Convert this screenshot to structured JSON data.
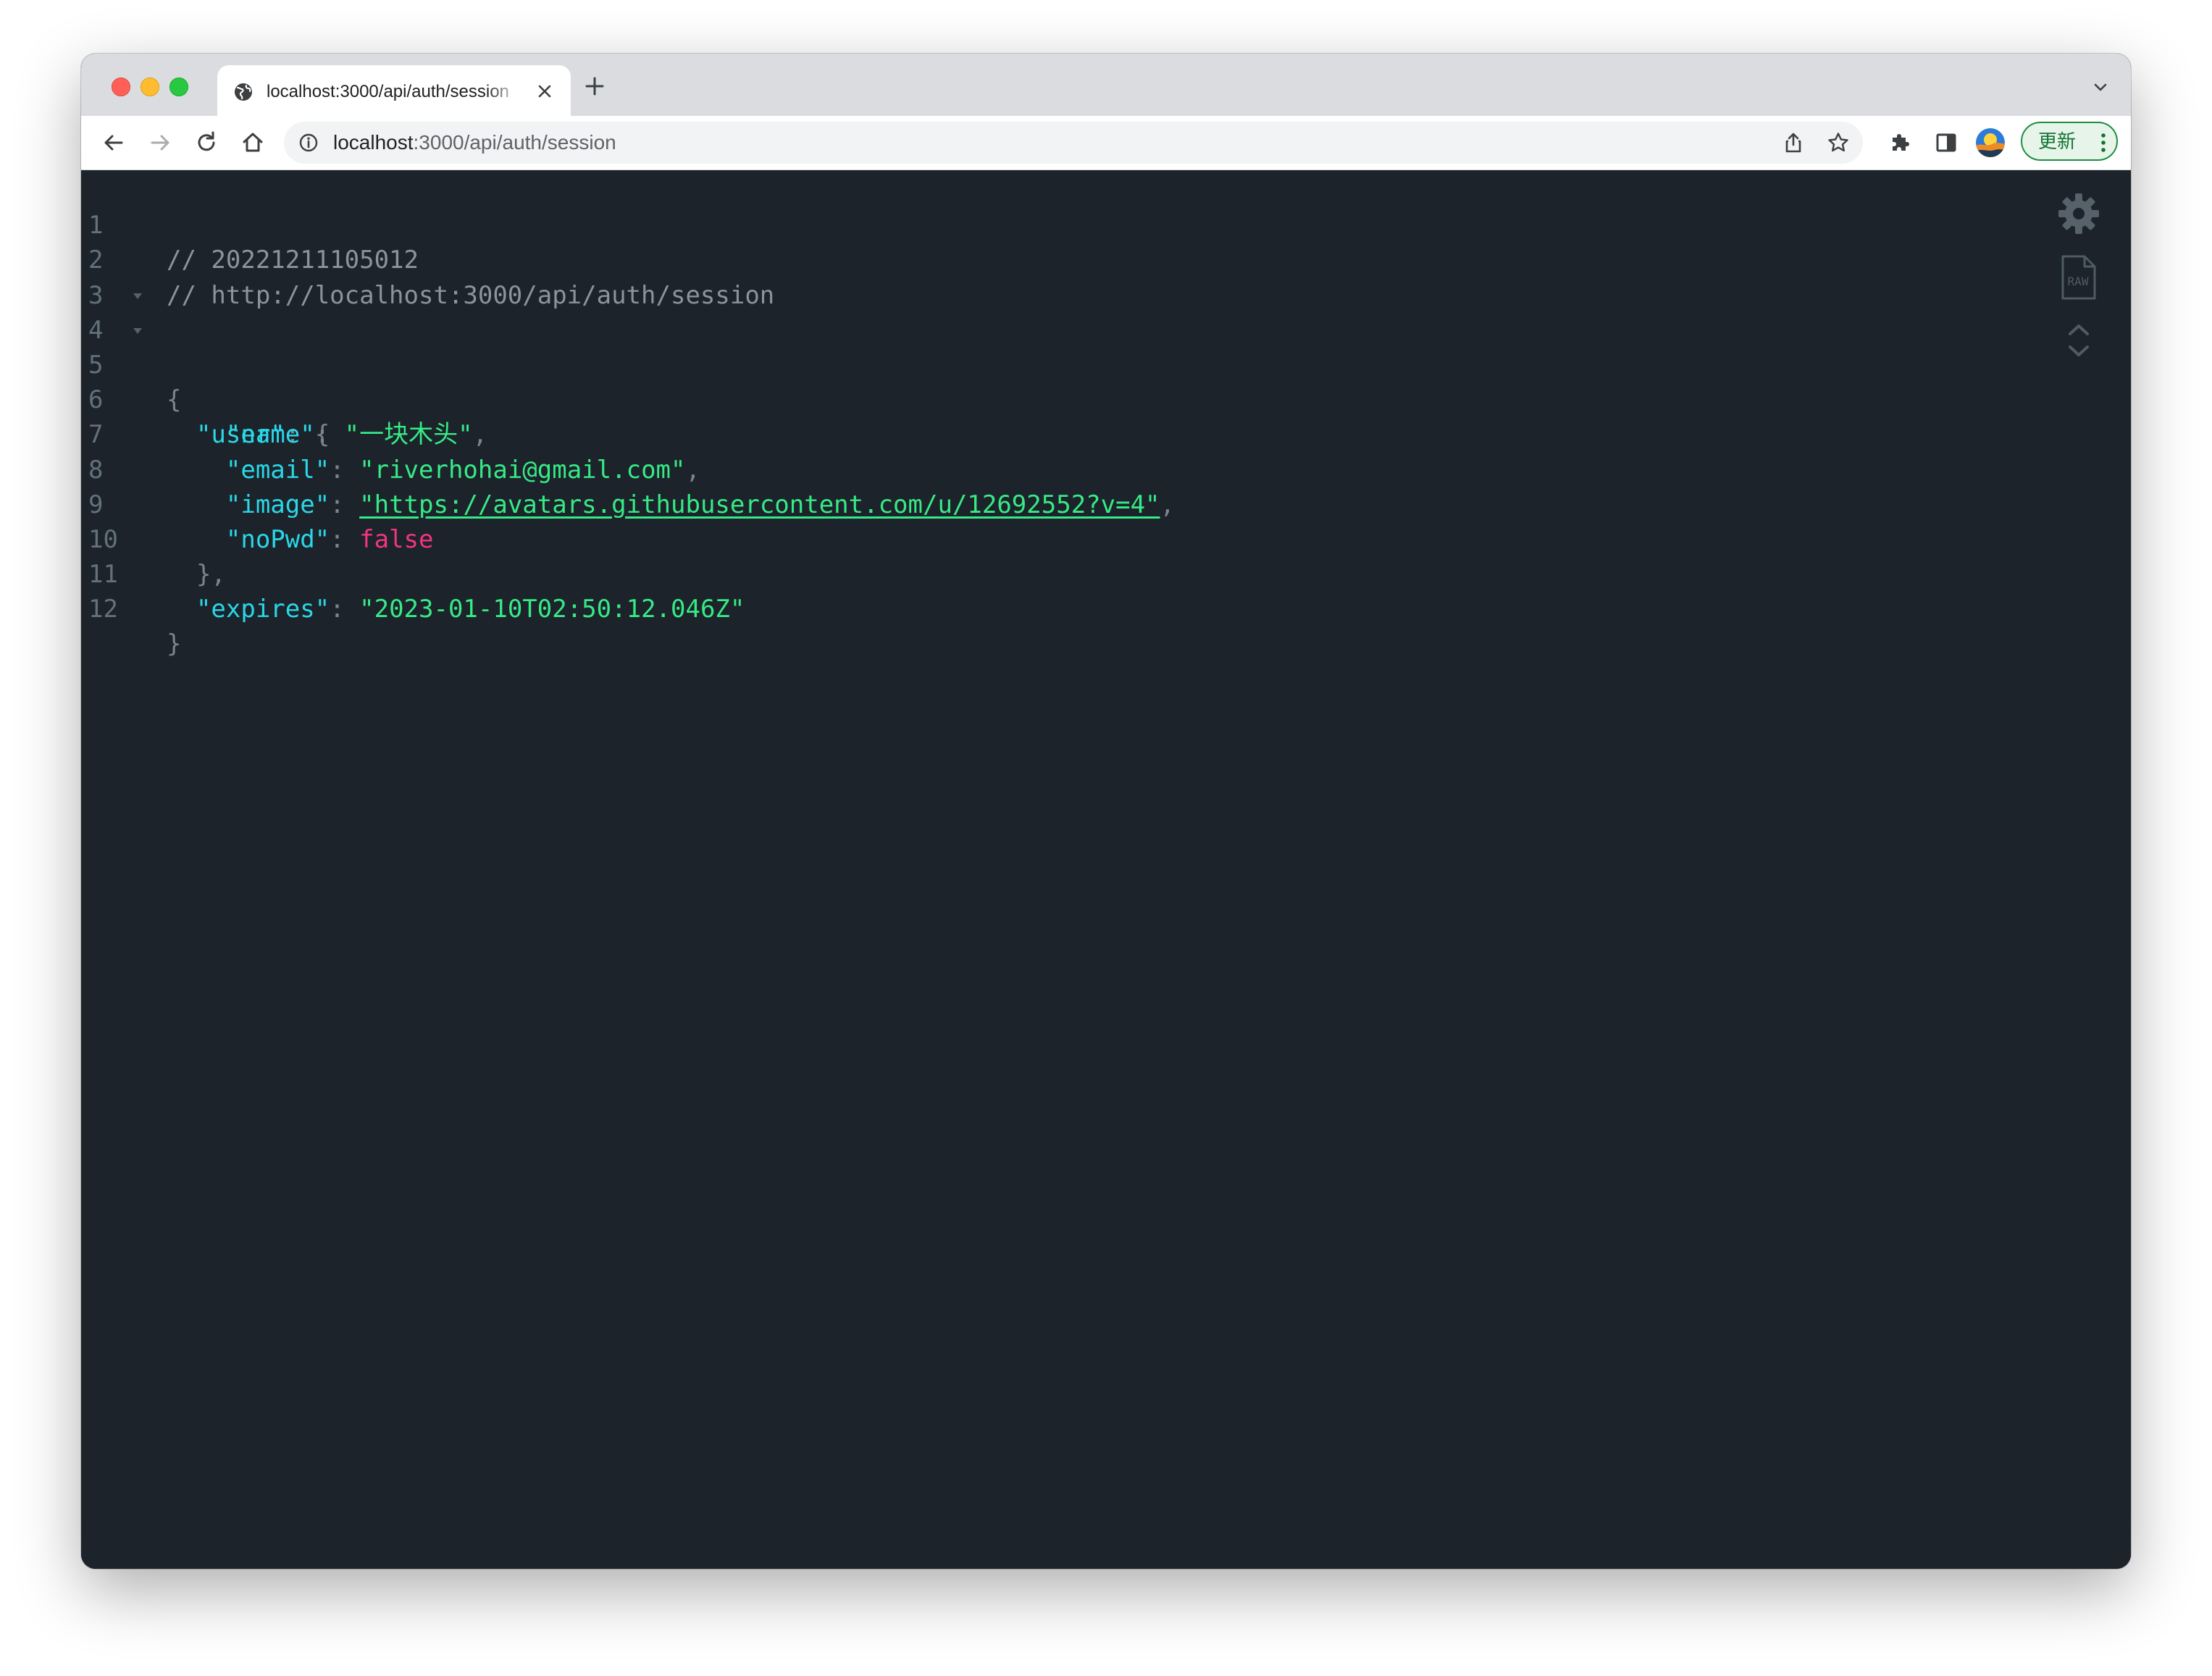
{
  "browser": {
    "tab": {
      "title": "localhost:3000/api/auth/session"
    },
    "omnibox": {
      "host": "localhost",
      "path": ":3000/api/auth/session"
    },
    "update_button": {
      "label": "更新"
    }
  },
  "json_viewer": {
    "lines": {
      "l1": {
        "n": "1",
        "comment": "// 20221211105012"
      },
      "l2": {
        "n": "2",
        "comment": "// http://localhost:3000/api/auth/session"
      },
      "l3": {
        "n": "3"
      },
      "l4": {
        "n": "4",
        "brace": "{"
      },
      "l5": {
        "n": "5",
        "key": "\"user\"",
        "sep": ": ",
        "brace": "{"
      },
      "l6": {
        "n": "6",
        "key": "\"name\"",
        "sep": ": ",
        "value": "\"一块木头\"",
        "trail": ","
      },
      "l7": {
        "n": "7",
        "key": "\"email\"",
        "sep": ": ",
        "value": "\"riverhohai@gmail.com\"",
        "trail": ","
      },
      "l8": {
        "n": "8",
        "key": "\"image\"",
        "sep": ": ",
        "value": "\"https://avatars.githubusercontent.com/u/12692552?v=4\"",
        "trail": ","
      },
      "l9": {
        "n": "9",
        "key": "\"noPwd\"",
        "sep": ": ",
        "value": "false"
      },
      "l10": {
        "n": "10",
        "brace": "},"
      },
      "l11": {
        "n": "11",
        "key": "\"expires\"",
        "sep": ": ",
        "value": "\"2023-01-10T02:50:12.046Z\""
      },
      "l12": {
        "n": "12",
        "brace": "}"
      }
    },
    "tools": {
      "raw_label": "RAW"
    }
  },
  "icons": {
    "tab_favicon": "globe-icon",
    "tab_close": "close-icon",
    "new_tab": "plus-icon",
    "tab_search": "chevron-down-icon",
    "back": "arrow-left-icon",
    "forward": "arrow-right-icon",
    "reload": "reload-icon",
    "home": "home-icon",
    "info": "info-icon",
    "share": "share-icon",
    "bookmark": "star-icon",
    "extensions": "puzzle-icon",
    "side_panel": "side-panel-icon",
    "settings": "gear-icon",
    "raw": "raw-file-icon",
    "collapse": "chevron-up-icon",
    "expand": "chevron-down-icon"
  },
  "colors": {
    "viewer_bg": "#1c232a",
    "key": "#2ad7e8",
    "string": "#36ea86",
    "boolean": "#f2347f",
    "comment": "#8a949b",
    "update_green": "#1e8e3e"
  }
}
